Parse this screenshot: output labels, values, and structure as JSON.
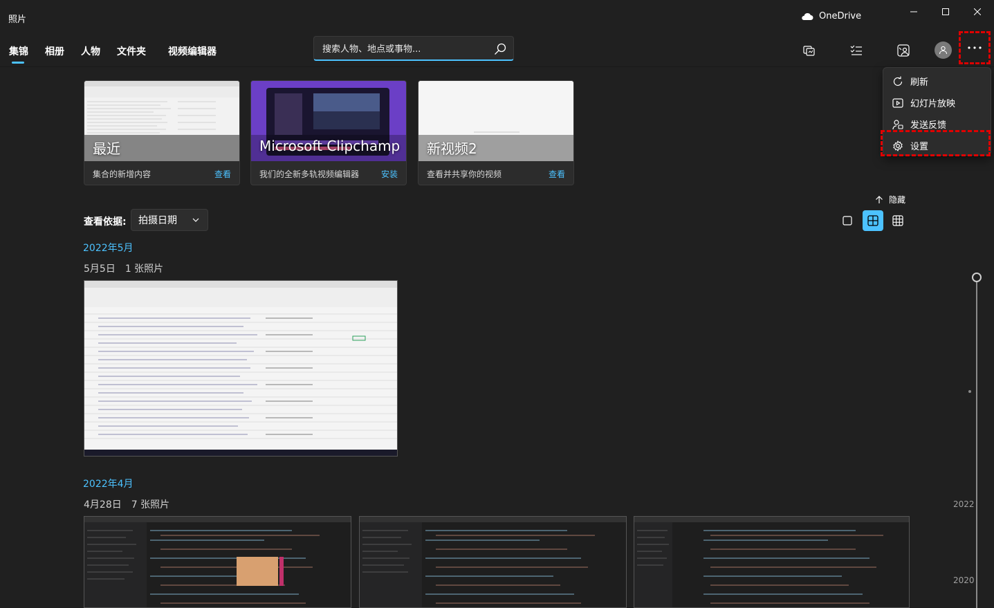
{
  "window": {
    "title": "照片",
    "onedrive_label": "OneDrive"
  },
  "nav": {
    "tabs": [
      "集锦",
      "相册",
      "人物",
      "文件夹",
      "视频编辑器"
    ],
    "active": "集锦"
  },
  "search": {
    "placeholder": "搜索人物、地点或事物..."
  },
  "cards": [
    {
      "title": "最近",
      "description": "集合的新增内容",
      "action": "查看"
    },
    {
      "title": "Microsoft Clipchamp",
      "description": "我们的全新多轨视频编辑器",
      "action": "安装"
    },
    {
      "title": "新视频2",
      "description": "查看并共享你的视频",
      "action": "查看"
    }
  ],
  "menu": {
    "items": [
      "刷新",
      "幻灯片放映",
      "发送反馈",
      "设置"
    ],
    "highlighted": "设置"
  },
  "controls": {
    "hide_label": "隐藏",
    "view_by_label": "查看依据:",
    "view_by_value": "拍摄日期"
  },
  "groups": [
    {
      "month": "2022年5月",
      "day": "5月5日",
      "count": "1 张照片"
    },
    {
      "month": "2022年4月",
      "day": "4月28日",
      "count": "7 张照片"
    }
  ],
  "timeline": {
    "years": [
      "2022",
      "2020"
    ]
  },
  "colors": {
    "accent": "#4cc2ff",
    "highlight": "#e00000",
    "background": "#202020"
  }
}
